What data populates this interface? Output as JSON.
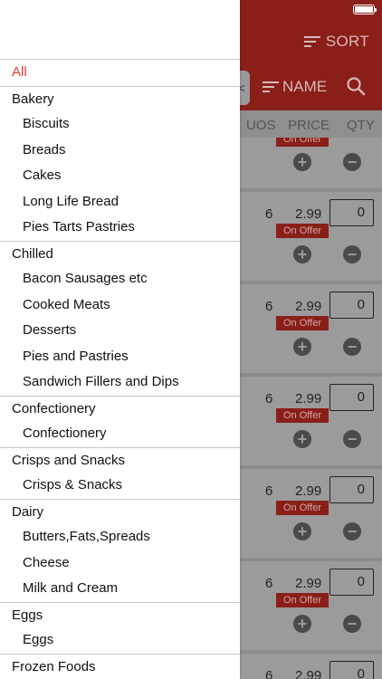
{
  "header": {
    "sort_label": "SORT",
    "name_label": "NAME",
    "back_glyph": "<"
  },
  "columns": {
    "uos": "UOS",
    "price": "PRICE",
    "qty": "QTY"
  },
  "first_row": {
    "offer": "On Offer"
  },
  "rows": [
    {
      "uos": "6",
      "price": "2.99",
      "qty": "0",
      "offer": "On Offer"
    },
    {
      "uos": "6",
      "price": "2.99",
      "qty": "0",
      "offer": "On Offer"
    },
    {
      "uos": "6",
      "price": "2.99",
      "qty": "0",
      "offer": "On Offer"
    },
    {
      "uos": "6",
      "price": "2.99",
      "qty": "0",
      "offer": "On Offer"
    },
    {
      "uos": "6",
      "price": "2.99",
      "qty": "0",
      "offer": "On Offer"
    },
    {
      "uos": "6",
      "price": "2.99",
      "qty": "0"
    }
  ],
  "drawer": {
    "items": [
      {
        "label": "All",
        "level": "all"
      },
      {
        "label": "Bakery",
        "level": "top"
      },
      {
        "label": "Biscuits",
        "level": "sub"
      },
      {
        "label": "Breads",
        "level": "sub"
      },
      {
        "label": "Cakes",
        "level": "sub"
      },
      {
        "label": "Long Life Bread",
        "level": "sub"
      },
      {
        "label": "Pies Tarts Pastries",
        "level": "sub"
      },
      {
        "label": "Chilled",
        "level": "top"
      },
      {
        "label": "Bacon Sausages etc",
        "level": "sub"
      },
      {
        "label": "Cooked Meats",
        "level": "sub"
      },
      {
        "label": "Desserts",
        "level": "sub"
      },
      {
        "label": "Pies and Pastries",
        "level": "sub"
      },
      {
        "label": "Sandwich Fillers and Dips",
        "level": "sub"
      },
      {
        "label": "Confectionery",
        "level": "top"
      },
      {
        "label": "Confectionery",
        "level": "sub"
      },
      {
        "label": "Crisps and Snacks",
        "level": "top"
      },
      {
        "label": "Crisps & Snacks",
        "level": "sub"
      },
      {
        "label": "Dairy",
        "level": "top"
      },
      {
        "label": "Butters,Fats,Spreads",
        "level": "sub"
      },
      {
        "label": "Cheese",
        "level": "sub"
      },
      {
        "label": "Milk and Cream",
        "level": "sub"
      },
      {
        "label": "Eggs",
        "level": "top"
      },
      {
        "label": "Eggs",
        "level": "sub"
      },
      {
        "label": "Frozen Foods",
        "level": "top"
      }
    ]
  },
  "colors": {
    "brand": "#c62828",
    "accent_selected": "#e53935"
  },
  "icons": {
    "sort": "sort-icon",
    "search": "search-icon",
    "plus": "plus-icon",
    "minus": "minus-icon",
    "battery": "battery-icon"
  }
}
